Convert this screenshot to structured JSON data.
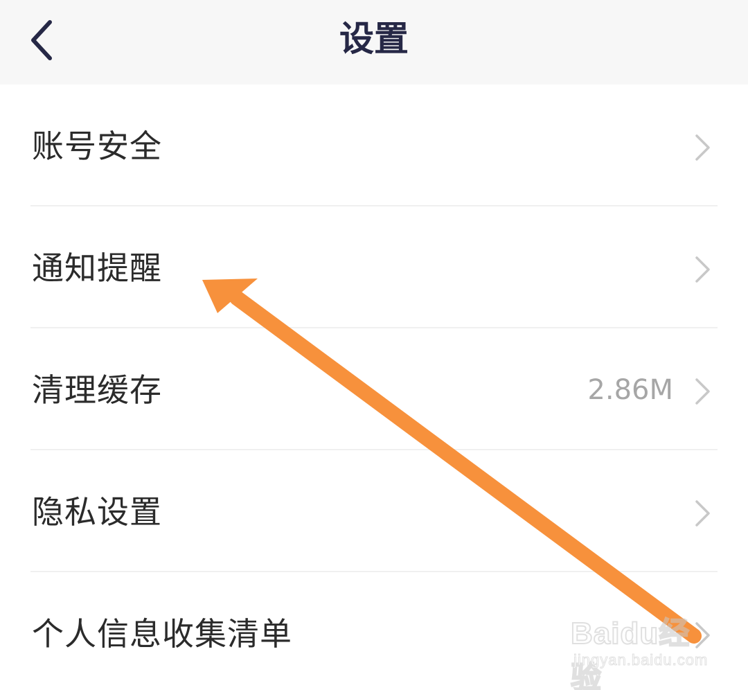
{
  "header": {
    "title": "设置",
    "back_icon": "chevron-left-icon"
  },
  "settings": {
    "items": [
      {
        "label": "账号安全",
        "value": ""
      },
      {
        "label": "通知提醒",
        "value": ""
      },
      {
        "label": "清理缓存",
        "value": "2.86M"
      },
      {
        "label": "隐私设置",
        "value": ""
      },
      {
        "label": "个人信息收集清单",
        "value": ""
      }
    ]
  },
  "annotation": {
    "arrow_color": "#f7913c"
  },
  "watermark": {
    "brand": "Baidu经验",
    "url": "jingyan.baidu.com"
  },
  "colors": {
    "header_bg": "#f7f7f7",
    "title": "#262846",
    "label": "#2b2b2b",
    "value": "#a6a6a6",
    "chevron": "#c8c8c8"
  }
}
